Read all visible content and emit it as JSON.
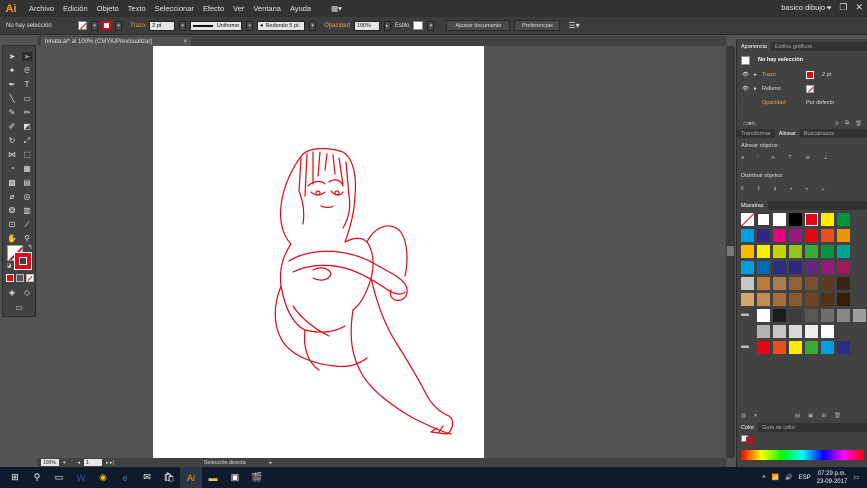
{
  "app": {
    "logo": "Ai"
  },
  "menu": [
    "Archivo",
    "Edición",
    "Objeto",
    "Texto",
    "Seleccionar",
    "Efecto",
    "Ver",
    "Ventana",
    "Ayuda"
  ],
  "workspace": "basico dibujo",
  "controlbar": {
    "selection": "No hay selección",
    "stroke_label": "Trazo",
    "stroke_value": "2 pt",
    "profile": "Uniforme",
    "brush": "Redondo 5 pt.",
    "opacity_label": "Opacidad",
    "opacity_value": "100%",
    "style_label": "Estilo",
    "doc_setup": "Ajustar documento",
    "preferences": "Preferencias"
  },
  "document_tab": {
    "title": "hinata.ai* al 100% (CMYK/Previsualizar)",
    "close": "×"
  },
  "status": {
    "zoom": "100%",
    "artboard": "1",
    "tool": "Selección directa"
  },
  "appearance": {
    "tabs": [
      "Apariencia",
      "Estilos gráficos"
    ],
    "title": "No hay selección",
    "stroke_label": "Trazo",
    "stroke_value": "2 pt",
    "fill_label": "Relleno",
    "opacity_label": "Opacidad",
    "opacity_value": "Por defecto"
  },
  "align": {
    "tabs": [
      "Transformar",
      "Alinear",
      "Buscatrazos"
    ],
    "align_objects": "Alinear objetos:",
    "distribute_objects": "Distribuir objetos:"
  },
  "swatches": {
    "tab": "Muestras",
    "rows": [
      [
        "#ffffff",
        "#ffffff",
        "#ffffff",
        "#000000",
        "#e30613",
        "#ffed00",
        "#00963f"
      ],
      [
        "#009fe3",
        "#312783",
        "#e6007e",
        "#951b81",
        "#e30613",
        "#e94e1b",
        "#f39200"
      ],
      [
        "#fbba00",
        "#ffed00",
        "#c6d300",
        "#95c11f",
        "#3aaa35",
        "#009640",
        "#00a19a"
      ],
      [
        "#009fe3",
        "#0069b4",
        "#2b2e83",
        "#312783",
        "#662483",
        "#951b81",
        "#a2195b"
      ],
      [
        "#c6c6c6",
        "#bc7a3e",
        "#ab7a53",
        "#936037",
        "#7a4e2d",
        "#5d3a1a",
        "#3c2415"
      ],
      [
        "#d3a86b",
        "#c28d51",
        "#a56e3b",
        "#8b5a2b",
        "#6e4520",
        "#513214",
        "#342009"
      ],
      [
        "#ffffff",
        "#1d1d1b",
        "#3c3c3b",
        "#575756",
        "#706f6f",
        "#878787",
        "#9d9d9c"
      ],
      [
        "#b2b2b2",
        "#c6c6c6",
        "#dadada",
        "#ededed",
        "#ffffff"
      ],
      [
        "#e30613",
        "#e94e1b",
        "#ffed00",
        "#3aaa35",
        "#009fe3",
        "#2b2e83"
      ]
    ]
  },
  "color": {
    "tabs": [
      "Color",
      "Guía de color"
    ]
  },
  "taskbar": {
    "lang": "ESP",
    "time": "07:29 p.m.",
    "date": "23-09-2017"
  },
  "colors": {
    "accent": "#ff9a00",
    "stroke": "#e30613"
  }
}
